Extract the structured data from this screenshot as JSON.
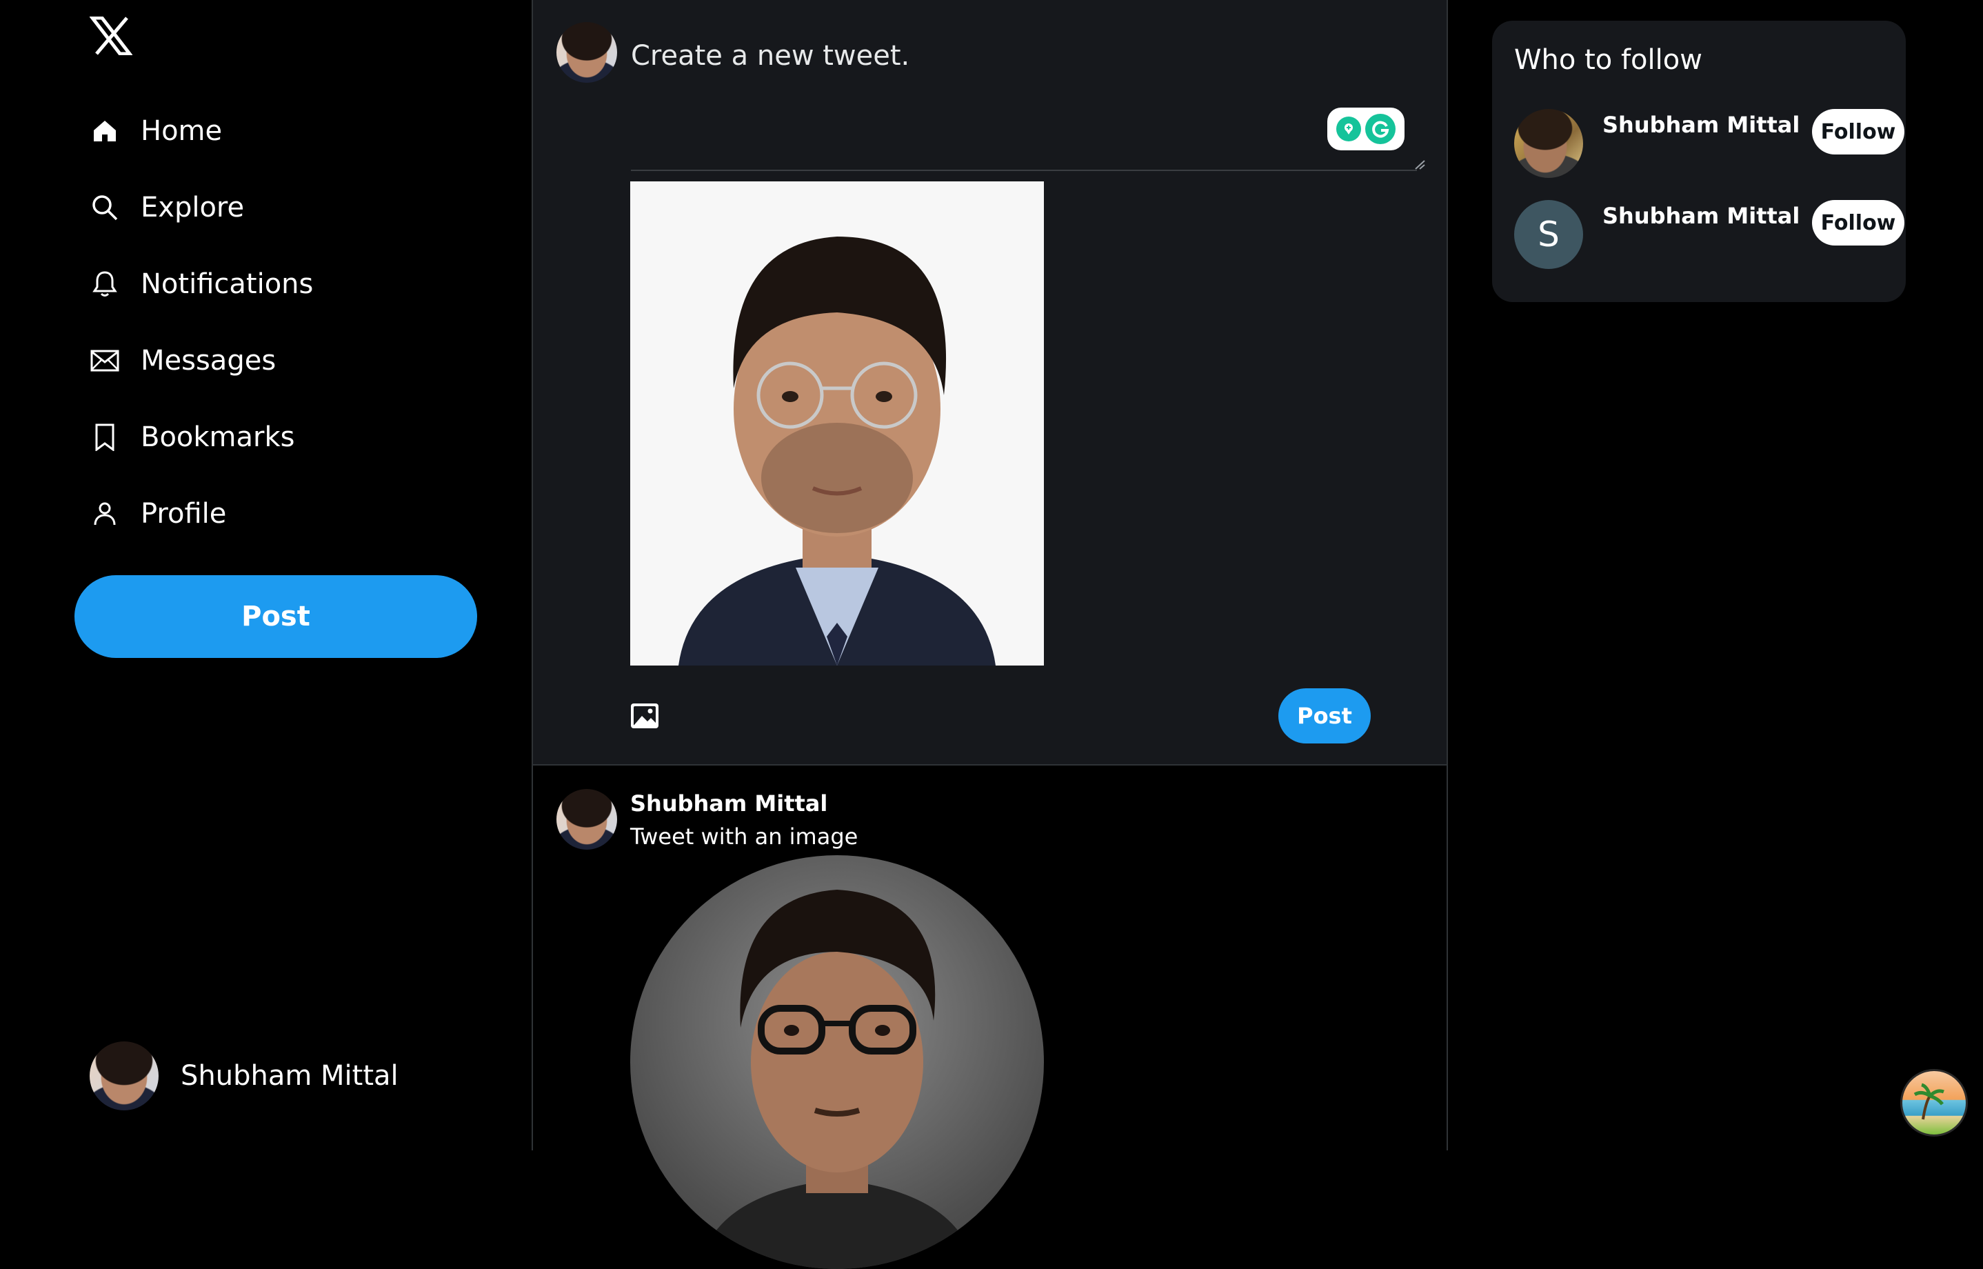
{
  "sidebar": {
    "logo": "X",
    "items": [
      {
        "label": "Home",
        "icon": "home-icon"
      },
      {
        "label": "Explore",
        "icon": "search-icon"
      },
      {
        "label": "Notifications",
        "icon": "bell-icon"
      },
      {
        "label": "Messages",
        "icon": "mail-icon"
      },
      {
        "label": "Bookmarks",
        "icon": "bookmark-icon"
      },
      {
        "label": "Profile",
        "icon": "person-icon"
      }
    ],
    "post_label": "Post",
    "account_name": "Shubham Mittal"
  },
  "composer": {
    "placeholder": "Create a new tweet.",
    "post_label": "Post",
    "media_icon": "image-icon"
  },
  "feed": {
    "tweets": [
      {
        "author": "Shubham Mittal",
        "text": "Tweet with an image"
      }
    ]
  },
  "who_to_follow": {
    "title": "Who to follow",
    "users": [
      {
        "name": "Shubham Mittal",
        "follow_label": "Follow"
      },
      {
        "name": "Shubham Mittal",
        "follow_label": "Follow",
        "avatar_letter": "S"
      }
    ]
  },
  "colors": {
    "accent": "#1d9bf0",
    "background": "#000000",
    "panel": "#16181c",
    "border": "#2f3336"
  }
}
